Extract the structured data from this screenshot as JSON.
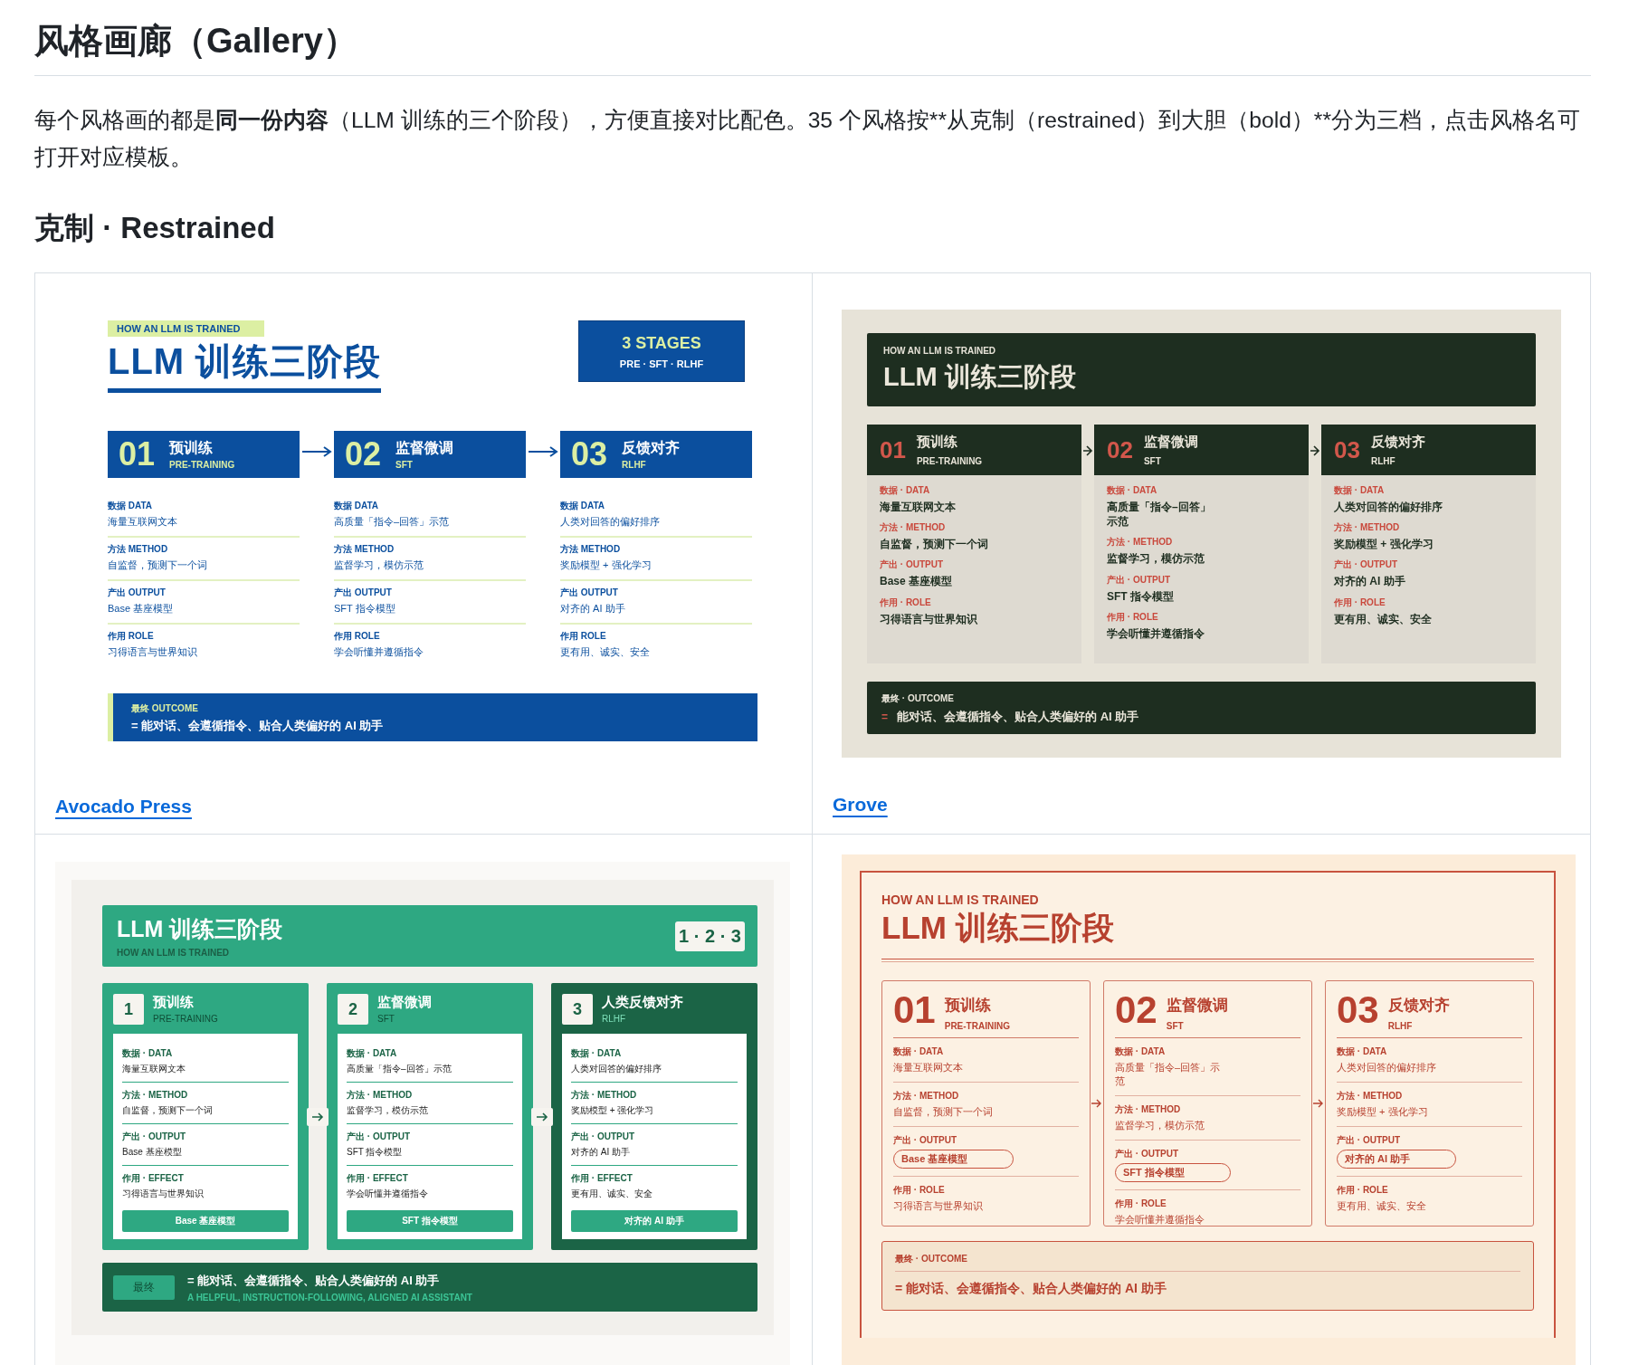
{
  "heading": "风格画廊（Gallery）",
  "intro": [
    {
      "text": "每个风格画的都是",
      "bold": false
    },
    {
      "text": "同一份内容",
      "bold": true
    },
    {
      "text": "（LLM 训练的三个阶段），方便直接对比配色。35 个风格按**从克制（restrained）到大胆（bold）**分为三档，点击风格名可打开对应模板。",
      "bold": false
    }
  ],
  "section": "克制 · Restrained",
  "gallery": [
    {
      "kind": "avocado",
      "name": "Avocado Press",
      "eyebrow": "HOW AN LLM IS TRAINED",
      "title": "LLM 训练三阶段",
      "badge": {
        "title": "3 STAGES",
        "subtitle": "PRE · SFT · RLHF"
      },
      "stages": [
        {
          "number": "01",
          "name": "预训练",
          "english": "PRE-TRAINING",
          "fields": [
            {
              "label": "数据 DATA",
              "value": "海量互联网文本"
            },
            {
              "label": "方法 METHOD",
              "value": "自监督，预测下一个词"
            },
            {
              "label": "产出 OUTPUT",
              "value": "Base 基座模型"
            },
            {
              "label": "作用 ROLE",
              "value": "习得语言与世界知识"
            }
          ]
        },
        {
          "number": "02",
          "name": "监督微调",
          "english": "SFT",
          "fields": [
            {
              "label": "数据 DATA",
              "value": "高质量「指令–回答」示范"
            },
            {
              "label": "方法 METHOD",
              "value": "监督学习，模仿示范"
            },
            {
              "label": "产出 OUTPUT",
              "value": "SFT 指令模型"
            },
            {
              "label": "作用 ROLE",
              "value": "学会听懂并遵循指令"
            }
          ]
        },
        {
          "number": "03",
          "name": "反馈对齐",
          "english": "RLHF",
          "fields": [
            {
              "label": "数据 DATA",
              "value": "人类对回答的偏好排序"
            },
            {
              "label": "方法 METHOD",
              "value": "奖励模型 + 强化学习"
            },
            {
              "label": "产出 OUTPUT",
              "value": "对齐的 AI 助手"
            },
            {
              "label": "作用 ROLE",
              "value": "更有用、诚实、安全"
            }
          ]
        }
      ],
      "outcome": {
        "label": "最终 OUTCOME",
        "text": "= 能对话、会遵循指令、贴合人类偏好的 AI 助手"
      }
    },
    {
      "kind": "grove",
      "name": "Grove",
      "eyebrow": "HOW AN LLM IS TRAINED",
      "title": "LLM 训练三阶段",
      "stages": [
        {
          "number": "01",
          "name": "预训练",
          "english": "PRE-TRAINING",
          "fields": [
            {
              "label": "数据 · DATA",
              "value": "海量互联网文本"
            },
            {
              "label": "方法 · METHOD",
              "value": "自监督，预测下一个词"
            },
            {
              "label": "产出 · OUTPUT",
              "value": "Base 基座模型"
            },
            {
              "label": "作用 · ROLE",
              "value": "习得语言与世界知识"
            }
          ]
        },
        {
          "number": "02",
          "name": "监督微调",
          "english": "SFT",
          "fields": [
            {
              "label": "数据 · DATA",
              "value": "高质量「指令–回答」示范"
            },
            {
              "label": "方法 · METHOD",
              "value": "监督学习，模仿示范"
            },
            {
              "label": "产出 · OUTPUT",
              "value": "SFT 指令模型"
            },
            {
              "label": "作用 · ROLE",
              "value": "学会听懂并遵循指令"
            }
          ]
        },
        {
          "number": "03",
          "name": "反馈对齐",
          "english": "RLHF",
          "fields": [
            {
              "label": "数据 · DATA",
              "value": "人类对回答的偏好排序"
            },
            {
              "label": "方法 · METHOD",
              "value": "奖励模型 + 强化学习"
            },
            {
              "label": "产出 · OUTPUT",
              "value": "对齐的 AI 助手"
            },
            {
              "label": "作用 · ROLE",
              "value": "更有用、诚实、安全"
            }
          ]
        }
      ],
      "outcome": {
        "label": "最终 · OUTCOME",
        "sign": "=",
        "text": "能对话、会遵循指令、贴合人类偏好的 AI 助手"
      }
    },
    {
      "kind": "mint",
      "eyebrow": "HOW AN LLM IS TRAINED",
      "title": "LLM 训练三阶段",
      "badge": {
        "title": "1 · 2 · 3"
      },
      "stages": [
        {
          "number": "1",
          "name": "预训练",
          "english": "PRE-TRAINING",
          "emphasis": false,
          "fields": [
            {
              "label": "数据 · DATA",
              "value": "海量互联网文本"
            },
            {
              "label": "方法 · METHOD",
              "value": "自监督，预测下一个词"
            },
            {
              "label": "产出 · OUTPUT",
              "value": "Base 基座模型"
            },
            {
              "label": "作用 · EFFECT",
              "value": "习得语言与世界知识"
            }
          ],
          "result": "Base 基座模型"
        },
        {
          "number": "2",
          "name": "监督微调",
          "english": "SFT",
          "emphasis": false,
          "fields": [
            {
              "label": "数据 · DATA",
              "value": "高质量「指令–回答」示范"
            },
            {
              "label": "方法 · METHOD",
              "value": "监督学习，模仿示范"
            },
            {
              "label": "产出 · OUTPUT",
              "value": "SFT 指令模型"
            },
            {
              "label": "作用 · EFFECT",
              "value": "学会听懂并遵循指令"
            }
          ],
          "result": "SFT 指令模型"
        },
        {
          "number": "3",
          "name": "人类反馈对齐",
          "english": "RLHF",
          "emphasis": true,
          "fields": [
            {
              "label": "数据 · DATA",
              "value": "人类对回答的偏好排序"
            },
            {
              "label": "方法 · METHOD",
              "value": "奖励模型 + 强化学习"
            },
            {
              "label": "产出 · OUTPUT",
              "value": "对齐的 AI 助手"
            },
            {
              "label": "作用 · EFFECT",
              "value": "更有用、诚实、安全"
            }
          ],
          "result": "对齐的 AI 助手"
        }
      ],
      "outcome": {
        "label": "最终",
        "text": "= 能对话、会遵循指令、贴合人类偏好的 AI 助手",
        "english": "A HELPFUL, INSTRUCTION-FOLLOWING, ALIGNED AI ASSISTANT"
      }
    },
    {
      "kind": "terracotta",
      "eyebrow": "HOW AN LLM IS TRAINED",
      "title": "LLM 训练三阶段",
      "stages": [
        {
          "number": "01",
          "name": "预训练",
          "english": "PRE-TRAINING",
          "fields": [
            {
              "label": "数据 · DATA",
              "value": "海量互联网文本",
              "kind": "text"
            },
            {
              "label": "方法 · METHOD",
              "value": "自监督，预测下一个词",
              "kind": "text"
            },
            {
              "label": "产出 · OUTPUT",
              "value": "Base 基座模型",
              "kind": "pill"
            },
            {
              "label": "作用 · ROLE",
              "value": "习得语言与世界知识",
              "kind": "text"
            }
          ]
        },
        {
          "number": "02",
          "name": "监督微调",
          "english": "SFT",
          "fields": [
            {
              "label": "数据 · DATA",
              "value": "高质量「指令–回答」示范",
              "kind": "text"
            },
            {
              "label": "方法 · METHOD",
              "value": "监督学习，模仿示范",
              "kind": "text"
            },
            {
              "label": "产出 · OUTPUT",
              "value": "SFT 指令模型",
              "kind": "pill"
            },
            {
              "label": "作用 · ROLE",
              "value": "学会听懂并遵循指令",
              "kind": "text"
            }
          ]
        },
        {
          "number": "03",
          "name": "反馈对齐",
          "english": "RLHF",
          "fields": [
            {
              "label": "数据 · DATA",
              "value": "人类对回答的偏好排序",
              "kind": "text"
            },
            {
              "label": "方法 · METHOD",
              "value": "奖励模型 + 强化学习",
              "kind": "text"
            },
            {
              "label": "产出 · OUTPUT",
              "value": "对齐的 AI 助手",
              "kind": "pill"
            },
            {
              "label": "作用 · ROLE",
              "value": "更有用、诚实、安全",
              "kind": "text"
            }
          ]
        }
      ],
      "outcome": {
        "label": "最终 · OUTCOME",
        "text": "= 能对话、会遵循指令、贴合人类偏好的 AI 助手"
      }
    }
  ]
}
